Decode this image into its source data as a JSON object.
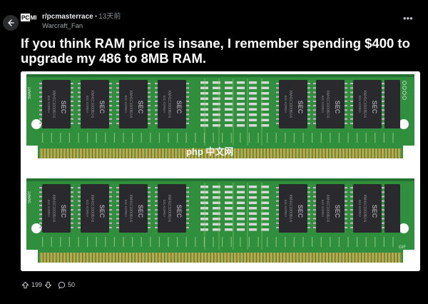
{
  "post": {
    "subreddit": "r/pcmasterrace",
    "separator": "•",
    "time_ago": "13天前",
    "author": "Warcraft_Fan",
    "title": "If you think RAM price is insane, I remember spending $400 to upgrade my 486 to 8MB RAM.",
    "vote_count": "199",
    "comment_count": "50"
  },
  "subreddit_icon": {
    "text": "PCMR"
  },
  "image": {
    "chip_top_line": "SEC",
    "chip_code": "KM41C1000BJ-6",
    "chip_date": "631 KOREA",
    "stick_label_left": "SMART",
    "stick_label_right": "GIF"
  },
  "watermark": {
    "text": "php 中文网"
  },
  "colors": {
    "pcb": "#2f8f3c",
    "pcb_dark": "#237030",
    "chip": "#2a2a2e",
    "gold": "#c9a24a",
    "background": "#000000"
  }
}
